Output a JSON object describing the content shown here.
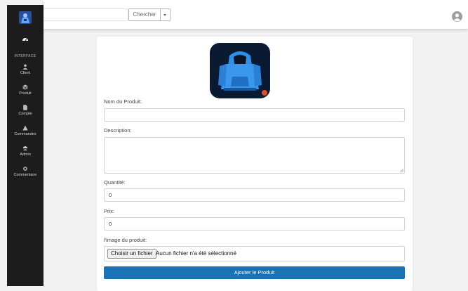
{
  "sidebar": {
    "section_label": "INTERFACE",
    "items": [
      {
        "label": "Client",
        "icon": "user-icon"
      },
      {
        "label": "Produit",
        "icon": "box-icon"
      },
      {
        "label": "Compte",
        "icon": "file-icon"
      },
      {
        "label": "Commandes",
        "icon": "warning-icon"
      },
      {
        "label": "Admin",
        "icon": "users-icon"
      },
      {
        "label": "Commentaire",
        "icon": "gear-icon"
      }
    ]
  },
  "topbar": {
    "search_value": "",
    "search_button": "Chercher"
  },
  "form": {
    "name_label": "Nom du Produit:",
    "name_value": "",
    "description_label": "Description:",
    "quantity_label": "Quantité:",
    "quantity_value": "0",
    "price_label": "Prix:",
    "price_value": "0",
    "image_label": "l'image du produit:",
    "file_button": "Choisir un fichier",
    "file_status": "Aucun fichier n'a été sélectionné",
    "submit_label": "Ajouter le Produit"
  },
  "colors": {
    "sidebar_bg": "#1c1c1c",
    "primary_button": "#1a73b5",
    "hoodie_blue": "#2f8ee6"
  }
}
